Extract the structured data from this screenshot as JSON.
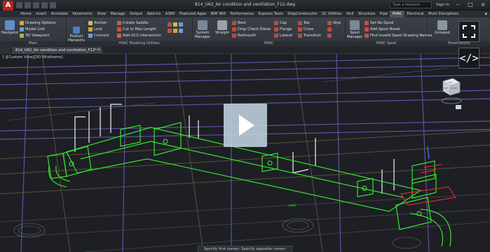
{
  "app": {
    "logo": "A",
    "title": "814_U62_Air condition and ventilation_F12.dwg",
    "search_placeholder": "Type a keyword",
    "sign_in": "Sign In"
  },
  "tabs": [
    "Home",
    "Insert",
    "Annotate",
    "Parametric",
    "View",
    "Manage",
    "Output",
    "Add-ins",
    "A360",
    "Featured Apps",
    "BIM 360",
    "Performance",
    "Express Tools",
    "ShipConstructor",
    "SC Utilities",
    "Hull",
    "Structure",
    "Pipe",
    "HVAC",
    "Electrical",
    "Multi Disciplines"
  ],
  "active_tab": "HVAC",
  "ribbon": {
    "main": {
      "title": "Main",
      "navigator": "Navigator",
      "items": [
        "Drawing Options",
        "Model Link",
        "3D Viewpoint"
      ]
    },
    "product_hierarchy": "Product Hierarchy",
    "modeling": {
      "title": "HVAC Modeling Utilities",
      "col1": [
        "Anchor",
        "Lock",
        "Connect"
      ],
      "col2": [
        "Create Saddle",
        "Cut to Max Length",
        "Add UCS Intersection"
      ]
    },
    "hvac": {
      "title": "HVAC",
      "system_manager": "System Manager",
      "straight": "Straight",
      "col1": [
        "Bent",
        "Drop Check Elbow",
        "Bellmouth"
      ],
      "col2": [
        "Cap",
        "Flange",
        "Lateral"
      ],
      "col3": [
        "Tee",
        "Cross",
        "Transition"
      ],
      "col4": [
        "Wye"
      ]
    },
    "spool": {
      "title": "HVAC Spool",
      "spool_manager": "Spool Manager",
      "items": [
        "Set No-Spool",
        "Add Spool Break",
        "Find Invalid Spool Drawing Names"
      ]
    },
    "penetrations": {
      "title": "Penetrations",
      "grouped": "Grouped"
    }
  },
  "file_tab": "814_U62_Air condition and ventilation_F12*",
  "viewport": {
    "label": "[-][Custom View][3D Wireframe]",
    "command": "Specify first corner: Specify opposite corner:",
    "viewcube_top": "TOP",
    "viewcube_left": "LEFT",
    "viewcube_front": "FRONT"
  },
  "overlay": {
    "code_label": "</>"
  },
  "colors": {
    "accent": "#b5241f",
    "model_green": "#35e22f",
    "model_purple": "#6a5bb8",
    "model_red": "#e0252a",
    "play_overlay": "#c2d3e0"
  }
}
